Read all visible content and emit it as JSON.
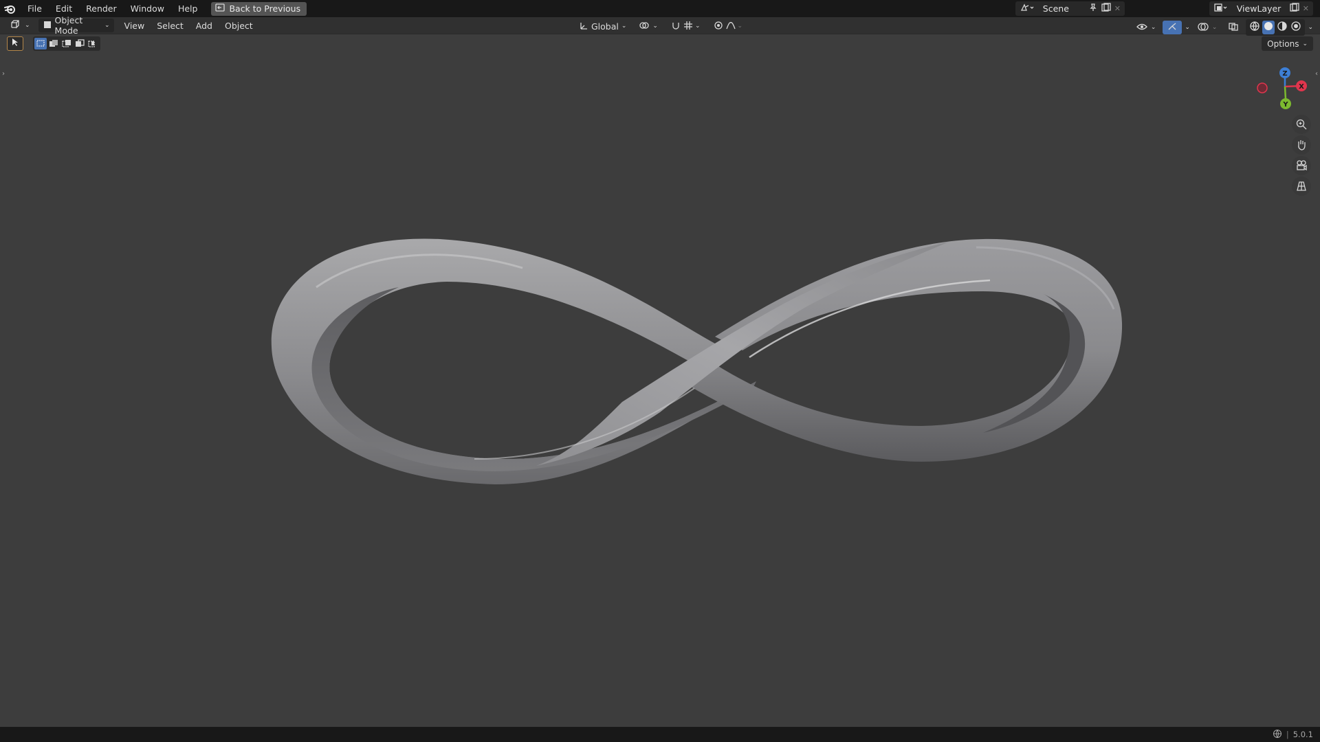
{
  "topbar": {
    "menu": [
      "File",
      "Edit",
      "Render",
      "Window",
      "Help"
    ],
    "back_label": "Back to Previous",
    "scene_name": "Scene",
    "view_layer": "ViewLayer"
  },
  "header": {
    "mode": "Object Mode",
    "menus": [
      "View",
      "Select",
      "Add",
      "Object"
    ],
    "transform_orientation": "Global"
  },
  "options_label": "Options",
  "gizmo": {
    "x": "X",
    "y": "Y",
    "z": "Z"
  },
  "status": {
    "version": "5.0.1"
  },
  "colors": {
    "viewport_bg": "#3d3d3d",
    "header_bg": "#303030",
    "topbar_bg": "#181818",
    "x_axis": "#e0354d",
    "y_axis": "#7cba2f",
    "z_axis": "#3d7fd6"
  }
}
